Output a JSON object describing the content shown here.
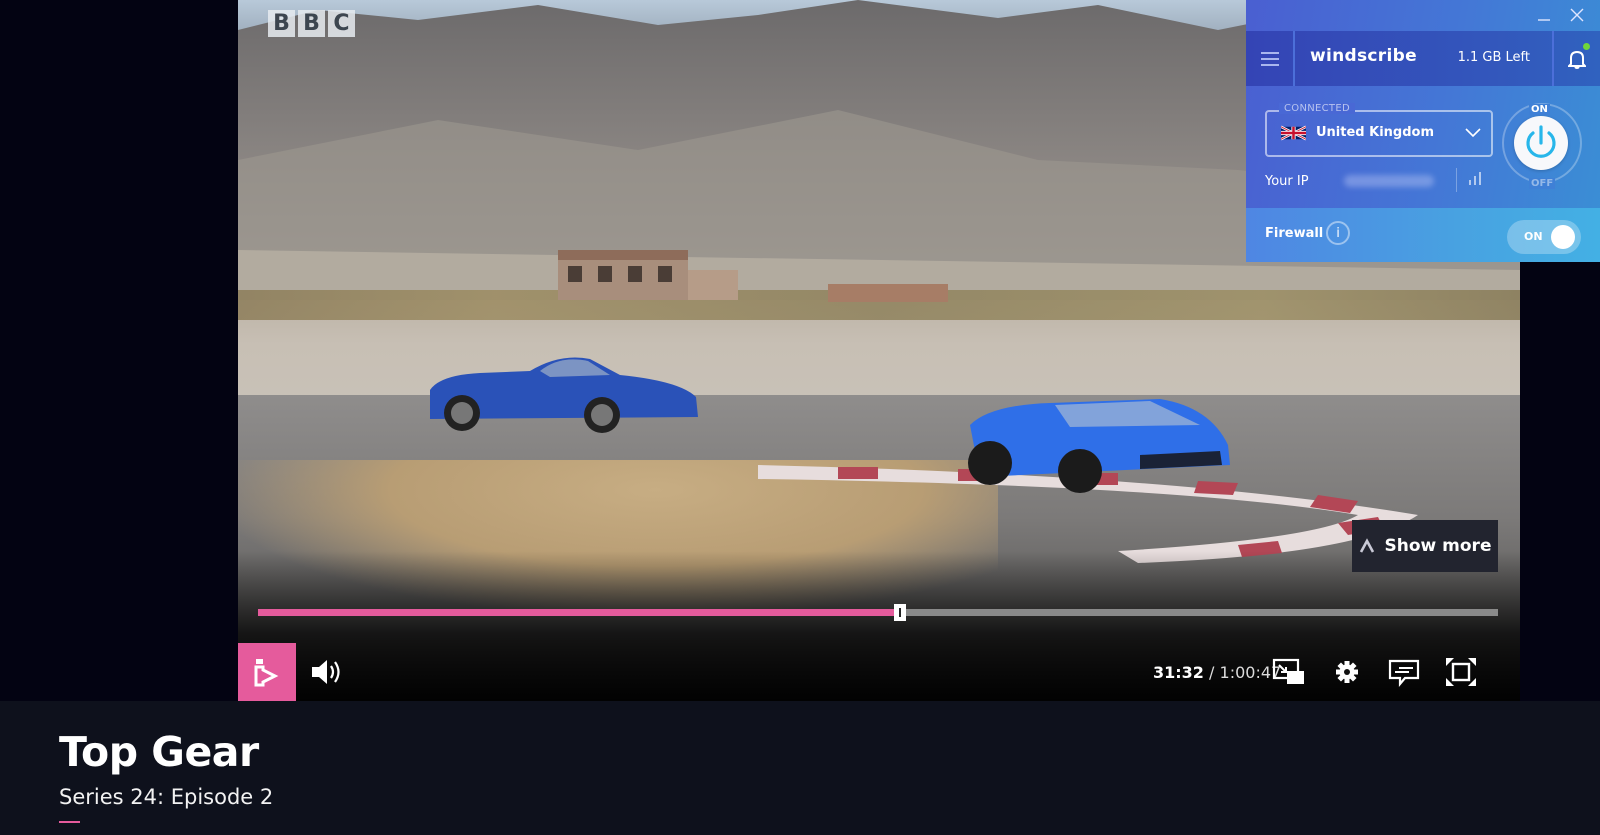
{
  "video": {
    "channel_logo": [
      "B",
      "B",
      "C"
    ],
    "show_more_label": "Show more",
    "progress_fraction": 0.518,
    "current_time": "31:32",
    "time_separator": "/",
    "duration": "1:00:47",
    "accent_color": "#e55b9c",
    "controls": {
      "iplayer_icon": "iplayer-logo-icon",
      "volume_icon": "volume-icon",
      "pip_icon": "picture-in-picture-icon",
      "settings_icon": "gear-icon",
      "subtitles_icon": "subtitles-icon",
      "fullscreen_icon": "fullscreen-icon"
    }
  },
  "programme": {
    "title": "Top Gear",
    "episode": "Series 24: Episode 2"
  },
  "windscribe": {
    "logo": "windscribe",
    "data_left": "1.1 GB Left",
    "status": "CONNECTED",
    "location": "United Kingdom",
    "ip_label": "Your IP",
    "power_on_label": "ON",
    "power_off_label": "OFF",
    "firewall_label": "Firewall",
    "firewall_info": "i",
    "firewall_state": "ON",
    "notification_dot_color": "#6fd63a"
  }
}
